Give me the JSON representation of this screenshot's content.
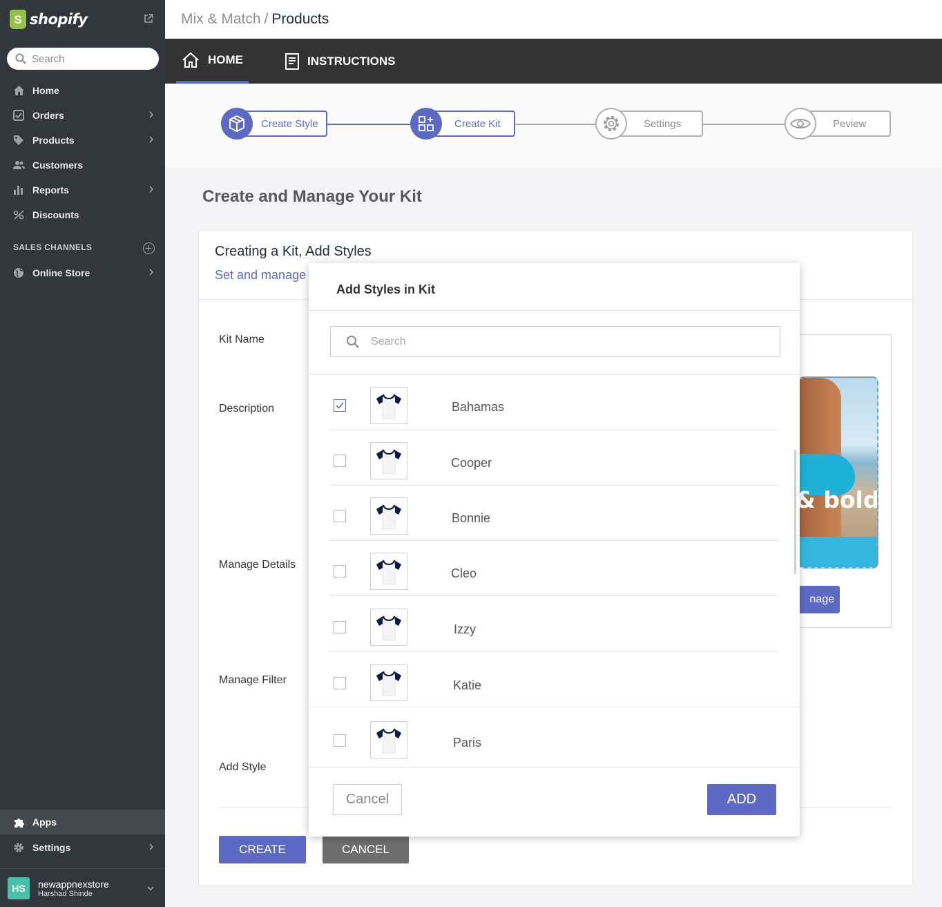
{
  "sidebar": {
    "brand": "shopify",
    "search_placeholder": "Search",
    "items": [
      {
        "label": "Home",
        "icon": "home-icon"
      },
      {
        "label": "Orders",
        "icon": "orders-icon"
      },
      {
        "label": "Products",
        "icon": "tag-icon"
      },
      {
        "label": "Customers",
        "icon": "customers-icon"
      },
      {
        "label": "Reports",
        "icon": "bar-chart-icon"
      },
      {
        "label": "Discounts",
        "icon": "discount-icon"
      }
    ],
    "sales_channels_label": "SALES CHANNELS",
    "online_store_label": "Online Store",
    "apps_label": "Apps",
    "settings_label": "Settings",
    "store": {
      "initials": "HS",
      "name": "newappnexstore",
      "user": "Harshad Shinde"
    }
  },
  "header": {
    "breadcrumb_parent": "Mix & Match",
    "breadcrumb_separator": "/",
    "breadcrumb_current": "Products"
  },
  "tabs": {
    "home": "HOME",
    "instructions": "INSTRUCTIONS"
  },
  "steps": {
    "create_style": "Create Style",
    "create_kit": "Create Kit",
    "settings": "Settings",
    "preview": "Peview",
    "accent_color": "#5c6ac4"
  },
  "main": {
    "title": "Create and Manage Your Kit",
    "card_title": "Creating a Kit, Add Styles",
    "card_subtitle": "Set and manage y",
    "fields": {
      "kit_name": "Kit Name",
      "description": "Description",
      "manage_details": "Manage Details",
      "manage_filter": "Manage Filter",
      "add_style": "Add Style"
    },
    "image_text": "& bolds",
    "image_button": "nage",
    "create_button": "CREATE",
    "cancel_button": "CANCEL"
  },
  "modal": {
    "title": "Add Styles in Kit",
    "search_placeholder": "Search",
    "styles": [
      {
        "name": "Bahamas",
        "checked": true
      },
      {
        "name": "Cooper",
        "checked": false
      },
      {
        "name": "Bonnie",
        "checked": false
      },
      {
        "name": "Cleo",
        "checked": false
      },
      {
        "name": "Izzy",
        "checked": false
      },
      {
        "name": "Katie",
        "checked": false
      },
      {
        "name": "Paris",
        "checked": false
      }
    ],
    "cancel_label": "Cancel",
    "add_label": "ADD"
  }
}
